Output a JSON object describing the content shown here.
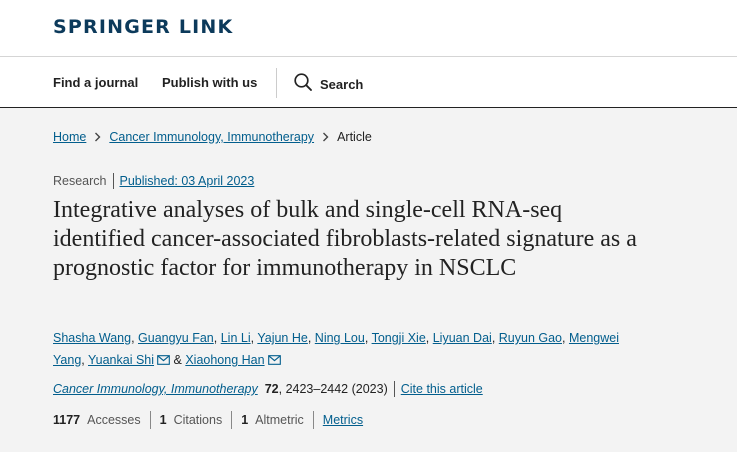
{
  "header": {
    "logo_text": "SPRINGER LINK"
  },
  "nav": {
    "find_journal": "Find a journal",
    "publish": "Publish with us",
    "search": "Search"
  },
  "breadcrumb": {
    "home": "Home",
    "journal": "Cancer Immunology, Immunotherapy",
    "current": "Article"
  },
  "article": {
    "type": "Research",
    "published": "Published: 03 April 2023",
    "title": "Integrative analyses of bulk and single-cell RNA-seq identified cancer-associated fibroblasts-related signature as a prognostic factor for immunotherapy in NSCLC",
    "authors": [
      "Shasha Wang",
      "Guangyu Fan",
      "Lin Li",
      "Yajun He",
      "Ning Lou",
      "Tongji Xie",
      "Liyuan Dai",
      "Ruyun Gao",
      "Mengwei Yang",
      "Yuankai Shi",
      "Xiaohong Han"
    ],
    "author_sep": ", ",
    "author_and": " & ",
    "journal": "Cancer Immunology, Immunotherapy",
    "volume": "72",
    "pages": ", 2423–2442 (2023)",
    "cite": "Cite this article"
  },
  "metrics": {
    "accesses_count": "1177",
    "accesses_label": "Accesses",
    "citations_count": "1",
    "citations_label": "Citations",
    "altmetric_count": "1",
    "altmetric_label": "Altmetric",
    "metrics_link": "Metrics"
  },
  "colors": {
    "link": "#025e8d",
    "logo": "#0c3a5b",
    "background": "#f3f3f3"
  }
}
